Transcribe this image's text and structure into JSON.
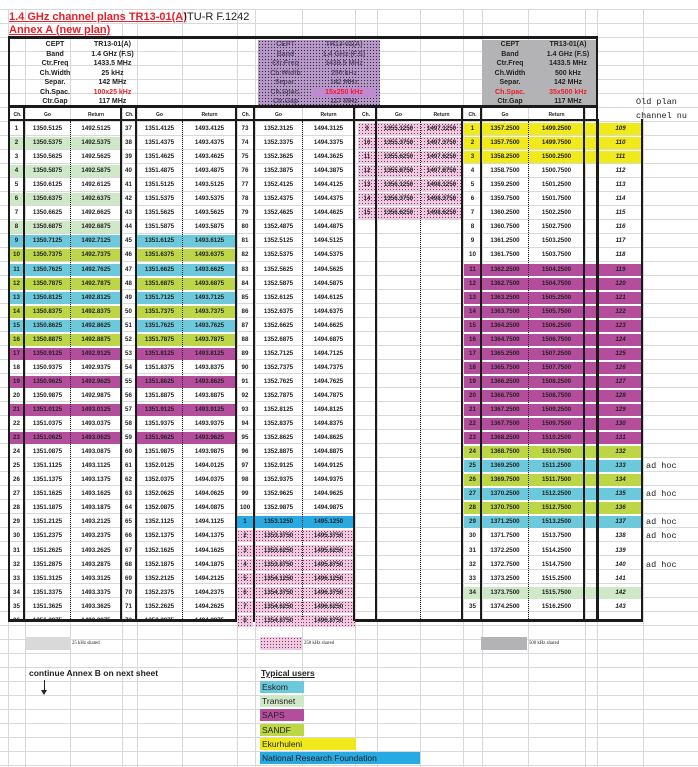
{
  "header": {
    "title": "1.4 GHz channel plans TR13-01(A)",
    "subtitle": "Annex A (new plan)",
    "reference": "ITU-R  F.1242"
  },
  "param_keys": [
    "CEPT",
    "Band",
    "Ctr.Freq",
    "Ch.Width",
    "Separ.",
    "Ch.Spac.",
    "Ctr.Gap"
  ],
  "plans": {
    "p25": {
      "values": [
        "TR13-01(A)",
        "1.4 GHz (F.S)",
        "1433.5 MHz",
        "25 kHz",
        "142 MHz",
        "100x25 kHz",
        "117 MHz"
      ],
      "shared_label": "25 kHz shared"
    },
    "p250": {
      "values": [
        "TR13-01(A)",
        "1.4 GHz (F.S)",
        "1433.5 MHz",
        "250 kHz",
        "142 MHz",
        "15x250 kHz",
        "117 MHz"
      ],
      "shared_label": "250 kHz shared"
    },
    "p500": {
      "values": [
        "TR13-01(A)",
        "1.4 GHz (F.S)",
        "1433.5 MHz",
        "500 kHz",
        "142 MHz",
        "35x500 kHz",
        "117 MHz"
      ],
      "shared_label": "500 kHz shared"
    }
  },
  "col_headers": {
    "ch": "Ch.",
    "go": "Go",
    "ret": "Return"
  },
  "old_plan_label": "Old plan",
  "channel_num_label": "channel nu",
  "colors": {
    "eskom": "#6cc9dc",
    "transnet": "#cfe8c8",
    "saps": "#b44e9c",
    "sandf": "#bdd646",
    "ekurhuleni": "#f1ea1a",
    "nrf": "#27a9e1",
    "grey25": "#d9d9d9",
    "grey500": "#b3b3b5"
  },
  "table25": {
    "col1": [
      [
        "1",
        "1350.5125",
        "1492.5125",
        ""
      ],
      [
        "2",
        "1350.5375",
        "1492.5375",
        "transnet"
      ],
      [
        "3",
        "1350.5625",
        "1492.5625",
        ""
      ],
      [
        "4",
        "1350.5875",
        "1492.5875",
        "transnet"
      ],
      [
        "5",
        "1350.6125",
        "1492.6125",
        ""
      ],
      [
        "6",
        "1350.6375",
        "1492.6375",
        "transnet"
      ],
      [
        "7",
        "1350.6625",
        "1492.6625",
        ""
      ],
      [
        "8",
        "1350.6875",
        "1492.6875",
        "transnet"
      ],
      [
        "9",
        "1350.7125",
        "1492.7125",
        "eskom"
      ],
      [
        "10",
        "1350.7375",
        "1492.7375",
        "sandf"
      ],
      [
        "11",
        "1350.7625",
        "1492.7625",
        "eskom"
      ],
      [
        "12",
        "1350.7875",
        "1492.7875",
        "sandf"
      ],
      [
        "13",
        "1350.8125",
        "1492.8125",
        "eskom"
      ],
      [
        "14",
        "1350.8375",
        "1492.8375",
        "sandf"
      ],
      [
        "15",
        "1350.8625",
        "1492.8625",
        "eskom"
      ],
      [
        "16",
        "1350.8875",
        "1492.8875",
        "sandf"
      ],
      [
        "17",
        "1350.9125",
        "1492.9125",
        "saps"
      ],
      [
        "18",
        "1350.9375",
        "1492.9375",
        ""
      ],
      [
        "19",
        "1350.9625",
        "1492.9625",
        "saps"
      ],
      [
        "20",
        "1350.9875",
        "1492.9875",
        ""
      ],
      [
        "21",
        "1351.0125",
        "1493.0125",
        "saps"
      ],
      [
        "22",
        "1351.0375",
        "1493.0375",
        ""
      ],
      [
        "23",
        "1351.0625",
        "1493.0625",
        "saps"
      ],
      [
        "24",
        "1351.0875",
        "1493.0875",
        ""
      ],
      [
        "25",
        "1351.1125",
        "1493.1125",
        ""
      ],
      [
        "26",
        "1351.1375",
        "1493.1375",
        ""
      ],
      [
        "27",
        "1351.1625",
        "1493.1625",
        ""
      ],
      [
        "28",
        "1351.1875",
        "1493.1875",
        ""
      ],
      [
        "29",
        "1351.2125",
        "1493.2125",
        ""
      ],
      [
        "30",
        "1351.2375",
        "1493.2375",
        ""
      ],
      [
        "31",
        "1351.2625",
        "1493.2625",
        ""
      ],
      [
        "32",
        "1351.2875",
        "1493.2875",
        ""
      ],
      [
        "33",
        "1351.3125",
        "1493.3125",
        ""
      ],
      [
        "34",
        "1351.3375",
        "1493.3375",
        ""
      ],
      [
        "35",
        "1351.3625",
        "1493.3625",
        ""
      ],
      [
        "36",
        "1351.3875",
        "1493.3875",
        ""
      ]
    ],
    "col2": [
      [
        "37",
        "1351.4125",
        "1493.4125",
        ""
      ],
      [
        "38",
        "1351.4375",
        "1493.4375",
        ""
      ],
      [
        "39",
        "1351.4625",
        "1493.4625",
        ""
      ],
      [
        "40",
        "1351.4875",
        "1493.4875",
        ""
      ],
      [
        "41",
        "1351.5125",
        "1493.5125",
        ""
      ],
      [
        "42",
        "1351.5375",
        "1493.5375",
        ""
      ],
      [
        "43",
        "1351.5625",
        "1493.5625",
        ""
      ],
      [
        "44",
        "1351.5875",
        "1493.5875",
        ""
      ],
      [
        "45",
        "1351.6125",
        "1493.6125",
        "eskom"
      ],
      [
        "46",
        "1351.6375",
        "1493.6375",
        "sandf"
      ],
      [
        "47",
        "1351.6625",
        "1493.6625",
        "eskom"
      ],
      [
        "48",
        "1351.6875",
        "1493.6875",
        "sandf"
      ],
      [
        "49",
        "1351.7125",
        "1493.7125",
        "eskom"
      ],
      [
        "50",
        "1351.7375",
        "1493.7375",
        "sandf"
      ],
      [
        "51",
        "1351.7625",
        "1493.7625",
        "eskom"
      ],
      [
        "52",
        "1351.7875",
        "1493.7875",
        "sandf"
      ],
      [
        "53",
        "1351.8125",
        "1493.8125",
        "saps"
      ],
      [
        "54",
        "1351.8375",
        "1493.8375",
        ""
      ],
      [
        "55",
        "1351.8625",
        "1493.8625",
        "saps"
      ],
      [
        "56",
        "1351.8875",
        "1493.8875",
        ""
      ],
      [
        "57",
        "1351.9125",
        "1493.9125",
        "saps"
      ],
      [
        "58",
        "1351.9375",
        "1493.9375",
        ""
      ],
      [
        "59",
        "1351.9625",
        "1493.9625",
        "saps"
      ],
      [
        "60",
        "1351.9875",
        "1493.9875",
        ""
      ],
      [
        "61",
        "1352.0125",
        "1494.0125",
        ""
      ],
      [
        "62",
        "1352.0375",
        "1494.0375",
        ""
      ],
      [
        "63",
        "1352.0625",
        "1494.0625",
        ""
      ],
      [
        "64",
        "1352.0875",
        "1494.0875",
        ""
      ],
      [
        "65",
        "1352.1125",
        "1494.1125",
        ""
      ],
      [
        "66",
        "1352.1375",
        "1494.1375",
        ""
      ],
      [
        "67",
        "1352.1625",
        "1494.1625",
        ""
      ],
      [
        "68",
        "1352.1875",
        "1494.1875",
        ""
      ],
      [
        "69",
        "1352.2125",
        "1494.2125",
        ""
      ],
      [
        "70",
        "1352.2375",
        "1494.2375",
        ""
      ],
      [
        "71",
        "1352.2625",
        "1494.2625",
        ""
      ],
      [
        "72",
        "1352.2875",
        "1494.2875",
        ""
      ]
    ],
    "col3": [
      [
        "73",
        "1352.3125",
        "1494.3125",
        ""
      ],
      [
        "74",
        "1352.3375",
        "1494.3375",
        ""
      ],
      [
        "75",
        "1352.3625",
        "1494.3625",
        ""
      ],
      [
        "76",
        "1352.3875",
        "1494.3875",
        ""
      ],
      [
        "77",
        "1352.4125",
        "1494.4125",
        ""
      ],
      [
        "78",
        "1352.4375",
        "1494.4375",
        ""
      ],
      [
        "79",
        "1352.4625",
        "1494.4625",
        ""
      ],
      [
        "80",
        "1352.4875",
        "1494.4875",
        ""
      ],
      [
        "81",
        "1352.5125",
        "1494.5125",
        ""
      ],
      [
        "82",
        "1352.5375",
        "1494.5375",
        ""
      ],
      [
        "83",
        "1352.5625",
        "1494.5625",
        ""
      ],
      [
        "84",
        "1352.5875",
        "1494.5875",
        ""
      ],
      [
        "85",
        "1352.6125",
        "1494.6125",
        ""
      ],
      [
        "86",
        "1352.6375",
        "1494.6375",
        ""
      ],
      [
        "87",
        "1352.6625",
        "1494.6625",
        ""
      ],
      [
        "88",
        "1352.6875",
        "1494.6875",
        ""
      ],
      [
        "89",
        "1352.7125",
        "1494.7125",
        ""
      ],
      [
        "90",
        "1352.7375",
        "1494.7375",
        ""
      ],
      [
        "91",
        "1352.7625",
        "1494.7625",
        ""
      ],
      [
        "92",
        "1352.7875",
        "1494.7875",
        ""
      ],
      [
        "93",
        "1352.8125",
        "1494.8125",
        ""
      ],
      [
        "94",
        "1352.8375",
        "1494.8375",
        ""
      ],
      [
        "95",
        "1352.8625",
        "1494.8625",
        ""
      ],
      [
        "96",
        "1352.8875",
        "1494.8875",
        ""
      ],
      [
        "97",
        "1352.9125",
        "1494.9125",
        ""
      ],
      [
        "98",
        "1352.9375",
        "1494.9375",
        ""
      ],
      [
        "99",
        "1352.9625",
        "1494.9625",
        ""
      ],
      [
        "100",
        "1352.9875",
        "1494.9875",
        ""
      ],
      [
        "1",
        "1353.1250",
        "1495.1250",
        "nrf"
      ],
      [
        "2",
        "1353.3750",
        "1495.3750",
        "stip"
      ],
      [
        "3",
        "1353.6250",
        "1495.6250",
        "stip"
      ],
      [
        "4",
        "1353.8750",
        "1495.8750",
        "stip"
      ],
      [
        "5",
        "1354.1250",
        "1496.1250",
        "stip"
      ],
      [
        "6",
        "1354.3750",
        "1496.3750",
        "stip"
      ],
      [
        "7",
        "1354.6250",
        "1496.6250",
        "stip"
      ],
      [
        "8",
        "1354.8750",
        "1496.8750",
        "stip"
      ]
    ]
  },
  "table250": [
    [
      "9",
      "1355.1250",
      "1497.1250"
    ],
    [
      "10",
      "1355.3750",
      "1497.3750"
    ],
    [
      "11",
      "1355.6250",
      "1497.6250"
    ],
    [
      "12",
      "1355.8750",
      "1497.8750"
    ],
    [
      "13",
      "1356.1250",
      "1498.1250"
    ],
    [
      "14",
      "1356.3750",
      "1498.3750"
    ],
    [
      "15",
      "1356.6250",
      "1498.6250"
    ]
  ],
  "table500": [
    [
      "1",
      "1357.2500",
      "1499.2500",
      "ekurhuleni",
      "109",
      ""
    ],
    [
      "2",
      "1357.7500",
      "1499.7500",
      "ekurhuleni",
      "110",
      ""
    ],
    [
      "3",
      "1358.2500",
      "1500.2500",
      "ekurhuleni",
      "111",
      ""
    ],
    [
      "4",
      "1358.7500",
      "1500.7500",
      "",
      "112",
      ""
    ],
    [
      "5",
      "1359.2500",
      "1501.2500",
      "",
      "113",
      ""
    ],
    [
      "6",
      "1359.7500",
      "1501.7500",
      "",
      "114",
      ""
    ],
    [
      "7",
      "1360.2500",
      "1502.2500",
      "",
      "115",
      ""
    ],
    [
      "8",
      "1360.7500",
      "1502.7500",
      "",
      "116",
      ""
    ],
    [
      "9",
      "1361.2500",
      "1503.2500",
      "",
      "117",
      ""
    ],
    [
      "10",
      "1361.7500",
      "1503.7500",
      "",
      "118",
      ""
    ],
    [
      "11",
      "1362.2500",
      "1504.2500",
      "saps",
      "119",
      ""
    ],
    [
      "12",
      "1362.7500",
      "1504.7500",
      "saps",
      "120",
      ""
    ],
    [
      "13",
      "1363.2500",
      "1505.2500",
      "saps",
      "121",
      ""
    ],
    [
      "14",
      "1363.7500",
      "1505.7500",
      "saps",
      "122",
      ""
    ],
    [
      "15",
      "1364.2500",
      "1506.2500",
      "saps",
      "123",
      ""
    ],
    [
      "16",
      "1364.7500",
      "1506.7500",
      "saps",
      "124",
      ""
    ],
    [
      "17",
      "1365.2500",
      "1507.2500",
      "saps",
      "125",
      ""
    ],
    [
      "18",
      "1365.7500",
      "1507.7500",
      "saps",
      "126",
      ""
    ],
    [
      "19",
      "1366.2500",
      "1508.2500",
      "saps",
      "127",
      ""
    ],
    [
      "20",
      "1366.7500",
      "1508.7500",
      "saps",
      "128",
      ""
    ],
    [
      "21",
      "1367.2500",
      "1509.2500",
      "saps",
      "129",
      ""
    ],
    [
      "22",
      "1367.7500",
      "1509.7500",
      "saps",
      "130",
      ""
    ],
    [
      "23",
      "1368.2500",
      "1510.2500",
      "saps",
      "131",
      ""
    ],
    [
      "24",
      "1368.7500",
      "1510.7500",
      "sandf",
      "132",
      ""
    ],
    [
      "25",
      "1369.2500",
      "1511.2500",
      "eskom",
      "133",
      "ad hoc"
    ],
    [
      "26",
      "1369.7500",
      "1511.7500",
      "sandf",
      "134",
      ""
    ],
    [
      "27",
      "1370.2500",
      "1512.2500",
      "eskom",
      "135",
      "ad hoc"
    ],
    [
      "28",
      "1370.7500",
      "1512.7500",
      "sandf",
      "136",
      ""
    ],
    [
      "29",
      "1371.2500",
      "1513.2500",
      "eskom",
      "137",
      "ad hoc"
    ],
    [
      "30",
      "1371.7500",
      "1513.7500",
      "",
      "138",
      "ad hoc"
    ],
    [
      "31",
      "1372.2500",
      "1514.2500",
      "",
      "139",
      ""
    ],
    [
      "32",
      "1372.7500",
      "1514.7500",
      "",
      "140",
      "ad hoc"
    ],
    [
      "33",
      "1373.2500",
      "1515.2500",
      "",
      "141",
      ""
    ],
    [
      "34",
      "1373.7500",
      "1515.7500",
      "transnet",
      "142",
      ""
    ],
    [
      "35",
      "1374.2500",
      "1516.2500",
      "",
      "143",
      ""
    ]
  ],
  "footer": {
    "continue_text": "continue Annex B on next sheet",
    "users_title": "Typical users",
    "users": [
      {
        "name": "Eskom",
        "color_key": "eskom"
      },
      {
        "name": "Transnet",
        "color_key": "transnet"
      },
      {
        "name": "SAPS",
        "color_key": "saps"
      },
      {
        "name": "SANDF",
        "color_key": "sandf"
      },
      {
        "name": "Ekurhuleni",
        "color_key": "ekurhuleni"
      },
      {
        "name": "National Research Foundation",
        "color_key": "nrf"
      }
    ]
  }
}
